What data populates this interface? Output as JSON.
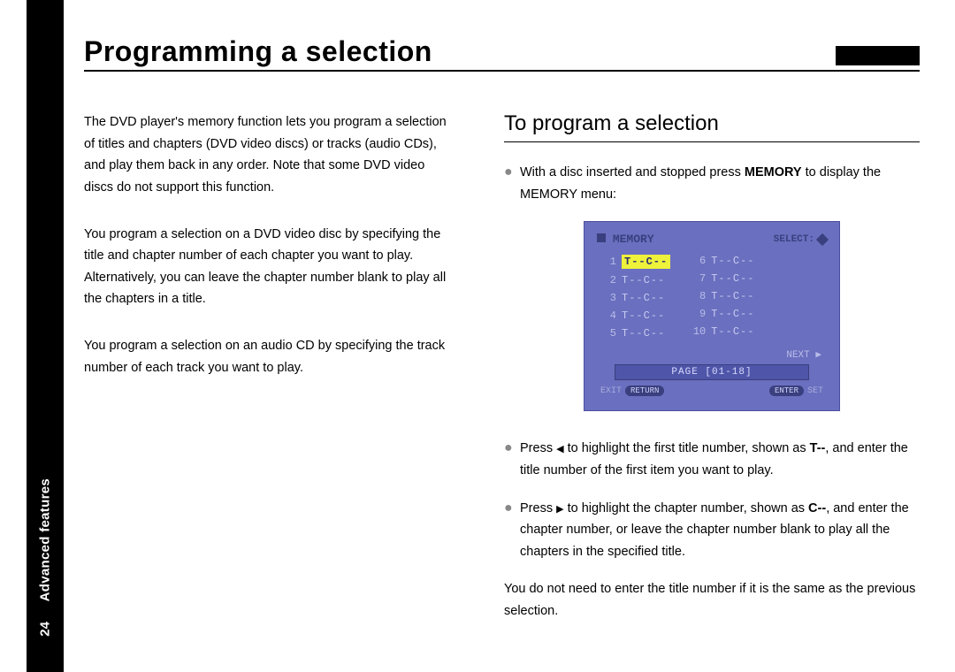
{
  "sidebar": {
    "section": "Advanced features",
    "page_number": "24"
  },
  "title": "Programming a selection",
  "left": {
    "p1": "The DVD player's memory function lets you program a selection of titles and chapters (DVD video discs) or tracks (audio CDs), and play them back in any order. Note that some DVD video discs do not support this function.",
    "p2": "You program a selection on a DVD video disc by specifying the title and chapter number of each chapter you want to play. Alternatively, you can leave the chapter number blank to play all the chapters in a title.",
    "p3": "You program a selection on an audio CD by specifying the track number of each track you want to play."
  },
  "right": {
    "heading": "To program a selection",
    "b1_pre": "With a disc inserted and stopped press ",
    "b1_bold": "MEMORY",
    "b1_post": " to display the MEMORY menu:",
    "b2_pre": "Press ",
    "b2_mid": " to highlight the first title number, shown as ",
    "b2_code": "T--",
    "b2_post": ", and enter the title number of the first item you want to play.",
    "b3_pre": "Press ",
    "b3_mid": " to highlight the chapter number, shown as ",
    "b3_code": "C--",
    "b3_post": ", and enter the chapter number, or leave the chapter number blank to play all the chapters in the specified title.",
    "note": "You do not need to enter the title number if it is the same as the previous selection."
  },
  "osd": {
    "title": "MEMORY",
    "select_label": "SELECT:",
    "left_rows": [
      {
        "n": "1",
        "v": "T--C--",
        "hl": true
      },
      {
        "n": "2",
        "v": "T--C--"
      },
      {
        "n": "3",
        "v": "T--C--"
      },
      {
        "n": "4",
        "v": "T--C--"
      },
      {
        "n": "5",
        "v": "T--C--"
      }
    ],
    "right_rows": [
      {
        "n": "6",
        "v": "T--C--"
      },
      {
        "n": "7",
        "v": "T--C--"
      },
      {
        "n": "8",
        "v": "T--C--"
      },
      {
        "n": "9",
        "v": "T--C--"
      },
      {
        "n": "10",
        "v": "T--C--"
      }
    ],
    "next": "NEXT ▶",
    "page": "PAGE  [01-18]",
    "exit_label": "EXIT",
    "exit_btn": "RETURN",
    "enter_btn": "ENTER",
    "enter_label": "SET"
  },
  "glyphs": {
    "left_tri": "◀",
    "right_tri": "▶",
    "bullet": "●"
  }
}
